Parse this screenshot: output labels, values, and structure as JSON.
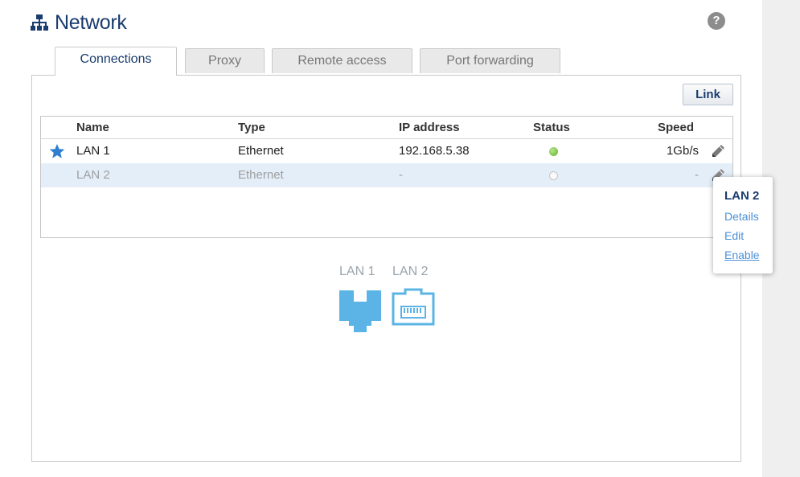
{
  "header": {
    "title": "Network",
    "icon": "network-icon",
    "help_icon": "question-icon",
    "help_glyph": "?"
  },
  "tabs": [
    {
      "label": "Connections",
      "active": true
    },
    {
      "label": "Proxy",
      "active": false
    },
    {
      "label": "Remote access",
      "active": false
    },
    {
      "label": "Port forwarding",
      "active": false
    }
  ],
  "toolbar": {
    "link_label": "Link"
  },
  "table": {
    "columns": [
      "Name",
      "Type",
      "IP address",
      "Status",
      "Speed"
    ],
    "rows": [
      {
        "name": "LAN 1",
        "type": "Ethernet",
        "ip": "192.168.5.38",
        "status": "connected",
        "speed": "1Gb/s",
        "primary": true
      },
      {
        "name": "LAN 2",
        "type": "Ethernet",
        "ip": "-",
        "status": "disconnected",
        "speed": "-",
        "primary": false
      }
    ]
  },
  "context_menu": {
    "title": "LAN 2",
    "items": [
      "Details",
      "Edit",
      "Enable"
    ]
  },
  "ports": {
    "labels": [
      "LAN 1",
      "LAN 2"
    ]
  },
  "colors": {
    "accent": "#1a3c6e",
    "link": "#4a90d9",
    "status_on": "#62b22c",
    "port_blue": "#5bb4e5",
    "selected_row": "#e3eef9"
  }
}
